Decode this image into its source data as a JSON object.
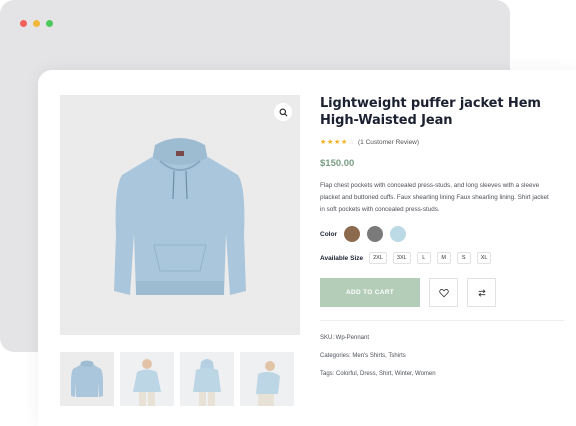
{
  "window": {
    "dots": [
      "#f0605a",
      "#f2b73b",
      "#4dc95b"
    ]
  },
  "product": {
    "title": "Lightweight puffer jacket Hem High-Waisted Jean",
    "rating": {
      "stars": 4,
      "max": 5,
      "review_text": "(1 Customer Review)"
    },
    "price": "$150.00",
    "description": "Flap chest pockets with concealed press-studs, and long sleeves with a sleeve placket and buttoned cuffs. Faux shearling lining Faux shearling lining. Shirt jacket in soft pockets with concealed press-studs.",
    "color_label": "Color",
    "colors": [
      "#8c6a4e",
      "#7a7a7a",
      "#bcd9e6"
    ],
    "size_label": "Available Size",
    "sizes": [
      "2XL",
      "3XL",
      "L",
      "M",
      "S",
      "XL"
    ],
    "add_to_cart": "ADD TO CART",
    "wishlist_icon": "heart-icon",
    "compare_icon": "compare-arrows-icon",
    "sku": "SKU: Wp-Pennant",
    "categories": "Categories: Men's Shirts, Tshirts",
    "tags": "Tags: Colorful, Dress, Shirt, Winter, Women"
  },
  "gallery": {
    "zoom_icon": "search-icon",
    "hoodie_color": "#a9c6dc",
    "thumbnails": [
      "hoodie-front",
      "model-front",
      "model-back",
      "model-side"
    ]
  }
}
